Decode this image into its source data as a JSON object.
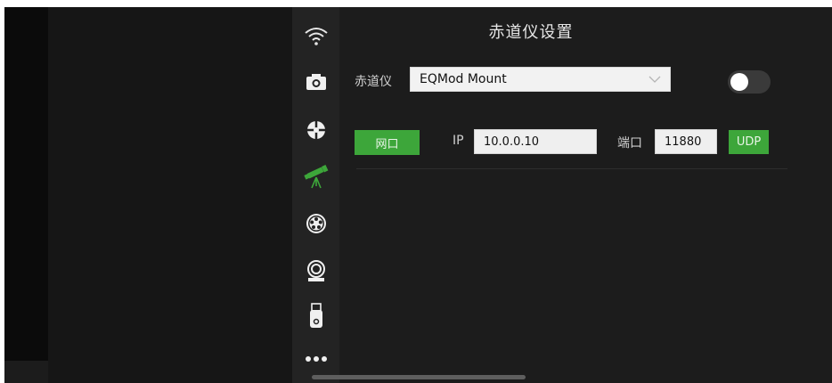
{
  "panel": {
    "title": "赤道仪设置",
    "mount_label": "赤道仪",
    "mount_selected": "EQMod Mount",
    "mount_enabled": false,
    "network_button": "网口",
    "ip_label": "IP",
    "ip_value": "10.0.0.10",
    "port_label": "端口",
    "port_value": "11880",
    "protocol_button": "UDP"
  },
  "sidebar": {
    "items": [
      {
        "icon": "wifi-icon",
        "active": false
      },
      {
        "icon": "camera-icon",
        "active": false
      },
      {
        "icon": "target-icon",
        "active": false
      },
      {
        "icon": "telescope-icon",
        "active": true
      },
      {
        "icon": "filter-wheel-icon",
        "active": false
      },
      {
        "icon": "focuser-icon",
        "active": false
      },
      {
        "icon": "usb-drive-icon",
        "active": false
      },
      {
        "icon": "more-icon",
        "active": false
      }
    ]
  },
  "colors": {
    "accent_green": "#3da63a",
    "background": "#1c1c1c",
    "sidebar": "#232323"
  }
}
